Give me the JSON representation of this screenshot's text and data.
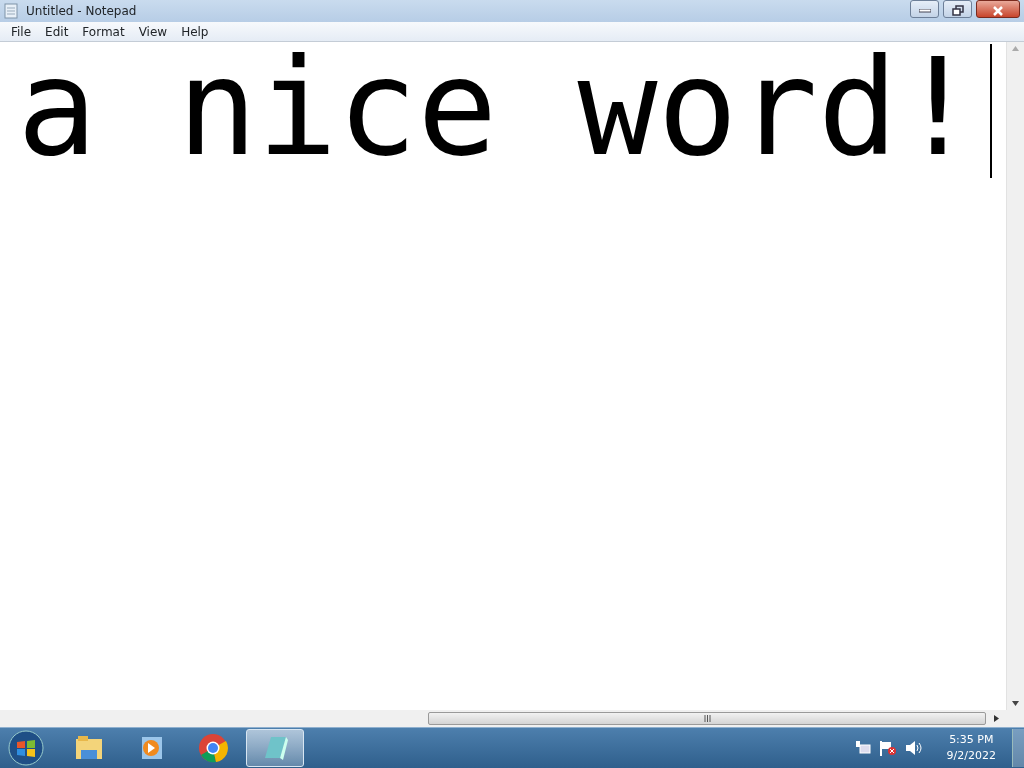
{
  "window": {
    "title": "Untitled - Notepad"
  },
  "menu": [
    "File",
    "Edit",
    "Format",
    "View",
    "Help"
  ],
  "editor": {
    "text": "a nice word!"
  },
  "taskbar": {
    "apps": [
      {
        "kind": "folder",
        "selected": false
      },
      {
        "kind": "player",
        "selected": false
      },
      {
        "kind": "browser",
        "selected": false
      },
      {
        "kind": "notepad",
        "selected": true
      }
    ],
    "clock": {
      "time": "5:35 PM",
      "date": "9/2/2022"
    }
  }
}
